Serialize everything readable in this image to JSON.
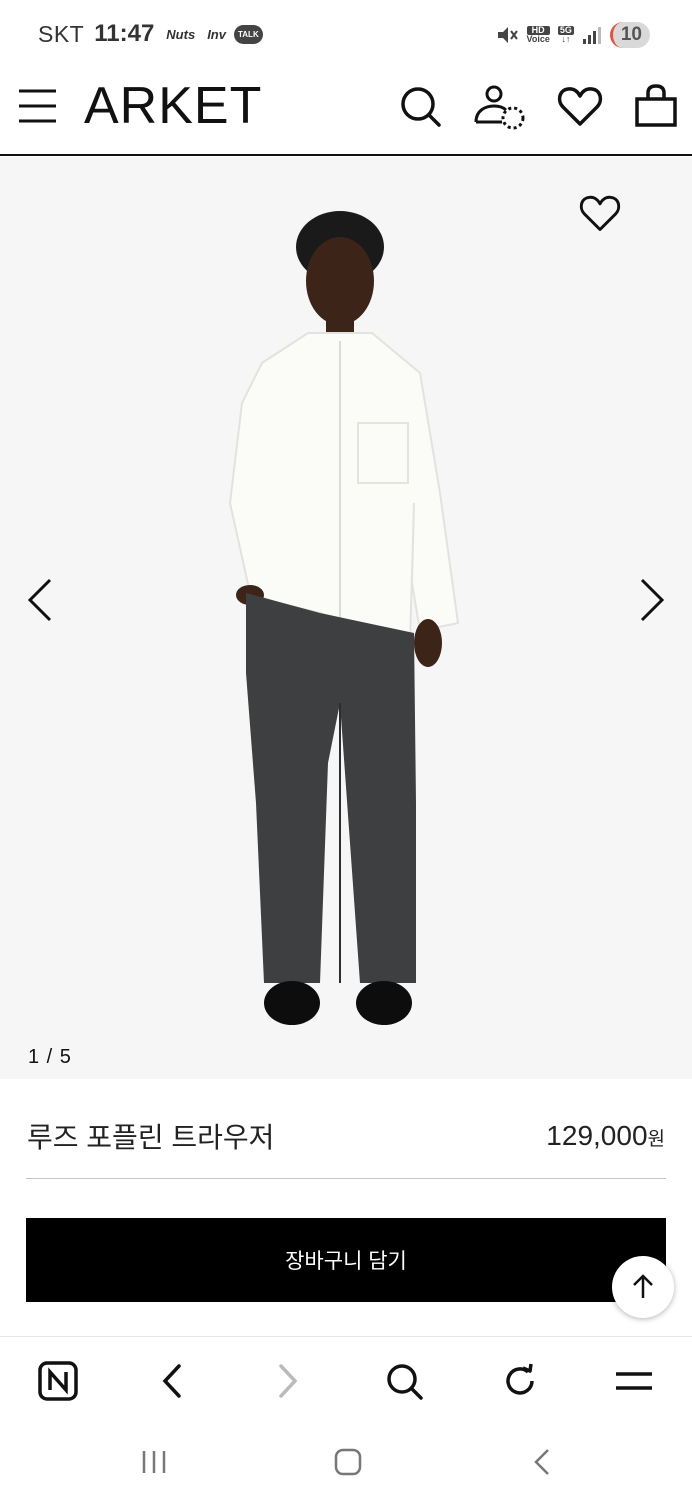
{
  "status_bar": {
    "carrier": "SKT",
    "time": "11:47",
    "app_icons": [
      "Nuts",
      "Inv",
      "TALK"
    ],
    "hd_voice_top": "HD",
    "hd_voice_bottom": "Voice",
    "network": "5G",
    "battery": "10"
  },
  "header": {
    "logo": "ARKET",
    "icons": [
      "menu-icon",
      "search-icon",
      "account-icon",
      "wishlist-icon",
      "shopping-bag-icon"
    ]
  },
  "gallery": {
    "counter": "1 / 5",
    "current_index": 1,
    "total": 5
  },
  "product": {
    "name": "루즈 포플린 트라우저",
    "price": "129,000",
    "currency": "원"
  },
  "cart_button": {
    "label": "장바구니 담기"
  },
  "browser_toolbar": {
    "icons": [
      "naver-home-icon",
      "back-icon",
      "forward-icon",
      "search-icon",
      "refresh-icon",
      "menu-icon"
    ]
  },
  "system_nav": {
    "icons": [
      "recent-apps-icon",
      "home-icon",
      "back-icon"
    ]
  },
  "colors": {
    "button_bg": "#000000",
    "image_bg": "#f6f6f6",
    "battery_accent": "#e0533f"
  }
}
